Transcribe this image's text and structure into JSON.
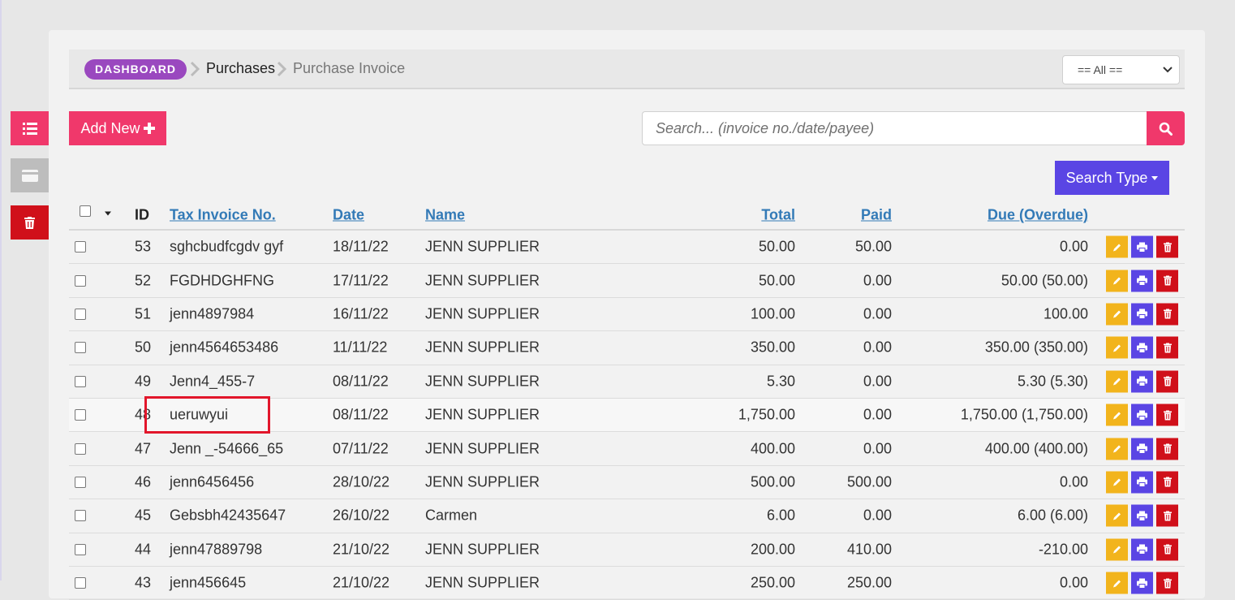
{
  "breadcrumb": {
    "dashboard": "DASHBOARD",
    "purchases": "Purchases",
    "current": "Purchase Invoice"
  },
  "filter": {
    "selected": "== All =="
  },
  "toolbar": {
    "add_new": "Add New",
    "search_placeholder": "Search... (invoice no./date/payee)",
    "search_type": "Search Type"
  },
  "table": {
    "headers": {
      "id": "ID",
      "tax_invoice_no": "Tax Invoice No.",
      "date": "Date",
      "name": "Name",
      "total": "Total",
      "paid": "Paid",
      "due": "Due (Overdue)"
    },
    "rows": [
      {
        "id": "53",
        "invoice": "sghcbudfcgdv gyf",
        "date": "18/11/22",
        "name": "JENN SUPPLIER",
        "total": "50.00",
        "paid": "50.00",
        "due": "0.00"
      },
      {
        "id": "52",
        "invoice": "FGDHDGHFNG",
        "date": "17/11/22",
        "name": "JENN SUPPLIER",
        "total": "50.00",
        "paid": "0.00",
        "due": "50.00 (50.00)"
      },
      {
        "id": "51",
        "invoice": "jenn4897984",
        "date": "16/11/22",
        "name": "JENN SUPPLIER",
        "total": "100.00",
        "paid": "0.00",
        "due": "100.00"
      },
      {
        "id": "50",
        "invoice": "jenn4564653486",
        "date": "11/11/22",
        "name": "JENN SUPPLIER",
        "total": "350.00",
        "paid": "0.00",
        "due": "350.00 (350.00)"
      },
      {
        "id": "49",
        "invoice": "Jenn4_455-7",
        "date": "08/11/22",
        "name": "JENN SUPPLIER",
        "total": "5.30",
        "paid": "0.00",
        "due": "5.30 (5.30)"
      },
      {
        "id": "48",
        "invoice": "ueruwyui",
        "date": "08/11/22",
        "name": "JENN SUPPLIER",
        "total": "1,750.00",
        "paid": "0.00",
        "due": "1,750.00 (1,750.00)"
      },
      {
        "id": "47",
        "invoice": "Jenn _-54666_65",
        "date": "07/11/22",
        "name": "JENN SUPPLIER",
        "total": "400.00",
        "paid": "0.00",
        "due": "400.00 (400.00)"
      },
      {
        "id": "46",
        "invoice": "jenn6456456",
        "date": "28/10/22",
        "name": "JENN SUPPLIER",
        "total": "500.00",
        "paid": "500.00",
        "due": "0.00"
      },
      {
        "id": "45",
        "invoice": "Gebsbh42435647",
        "date": "26/10/22",
        "name": "Carmen",
        "total": "6.00",
        "paid": "0.00",
        "due": "6.00 (6.00)"
      },
      {
        "id": "44",
        "invoice": "jenn47889798",
        "date": "21/10/22",
        "name": "JENN SUPPLIER",
        "total": "200.00",
        "paid": "410.00",
        "due": "-210.00"
      },
      {
        "id": "43",
        "invoice": "jenn456645",
        "date": "21/10/22",
        "name": "JENN SUPPLIER",
        "total": "250.00",
        "paid": "250.00",
        "due": "0.00"
      }
    ]
  },
  "colors": {
    "pink": "#f0386b",
    "purple": "#5a45e4",
    "violet": "#9a48bf",
    "yellow": "#f2b41c",
    "red": "#d0101a",
    "link": "#337ab7"
  }
}
